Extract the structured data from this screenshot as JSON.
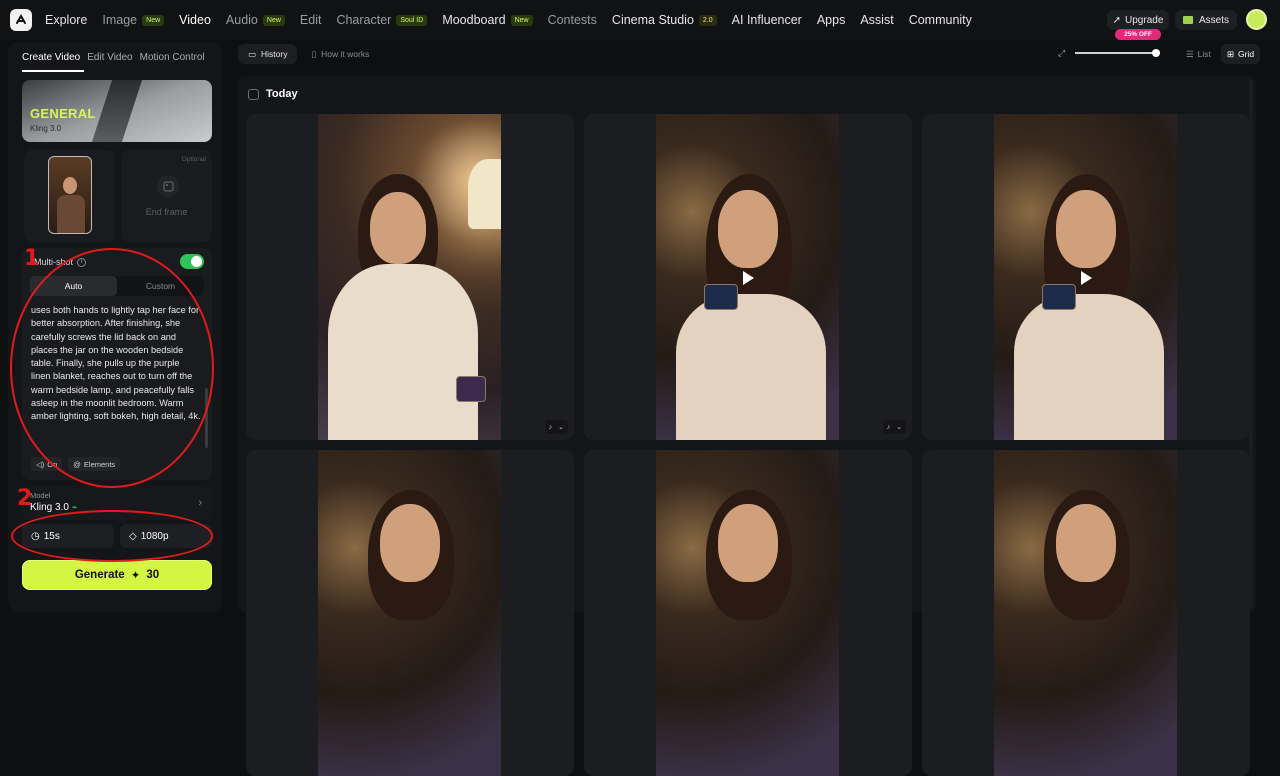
{
  "nav": {
    "items": [
      {
        "label": "Explore",
        "tag": "",
        "state": "bright"
      },
      {
        "label": "Image",
        "tag": "New",
        "state": "dim"
      },
      {
        "label": "Video",
        "tag": "",
        "state": "active"
      },
      {
        "label": "Audio",
        "tag": "New",
        "state": "dim"
      },
      {
        "label": "Edit",
        "tag": "",
        "state": "dim"
      },
      {
        "label": "Character",
        "tag": "Soul ID",
        "state": "dim"
      },
      {
        "label": "Moodboard",
        "tag": "New",
        "state": "bright"
      },
      {
        "label": "Contests",
        "tag": "",
        "state": "dim"
      },
      {
        "label": "Cinema Studio",
        "tag": "2.0",
        "state": "bright"
      },
      {
        "label": "AI Influencer",
        "tag": "",
        "state": "bright"
      },
      {
        "label": "Apps",
        "tag": "",
        "state": "bright"
      },
      {
        "label": "Assist",
        "tag": "",
        "state": "bright"
      },
      {
        "label": "Community",
        "tag": "",
        "state": "bright"
      }
    ],
    "upgrade": "Upgrade",
    "discount": "25% OFF",
    "assets": "Assets"
  },
  "left": {
    "tabs": [
      "Create Video",
      "Edit Video",
      "Motion Control"
    ],
    "preset": {
      "title": "GENERAL",
      "model": "Kling 3.0"
    },
    "end_frame": {
      "optional": "Optional",
      "label": "End frame"
    },
    "multishot": {
      "label": "Multi-shot",
      "enabled": true
    },
    "segments": [
      "Auto",
      "Custom"
    ],
    "prompt": "uses both hands to lightly tap her face for better absorption. After finishing, she carefully screws the lid back on and places the jar on the wooden bedside table. Finally, she pulls up the purple linen blanket, reaches out to turn off the warm bedside lamp, and peacefully falls asleep in the moonlit bedroom. Warm amber lighting, soft bokeh, high detail, 4k.",
    "audio_chip": "On",
    "elements_chip": "Elements",
    "model": {
      "label": "Model",
      "value": "Kling 3.0"
    },
    "duration": "15s",
    "resolution": "1080p",
    "generate": {
      "label": "Generate",
      "cost": "30"
    }
  },
  "annotations": [
    "1",
    "2"
  ],
  "main": {
    "tabs": [
      "History",
      "How it works"
    ],
    "views": [
      "List",
      "Grid"
    ],
    "section": "Today"
  },
  "colors": {
    "accent": "#d5f542",
    "annotation": "#e01b1b",
    "toggle": "#2fc45a"
  }
}
